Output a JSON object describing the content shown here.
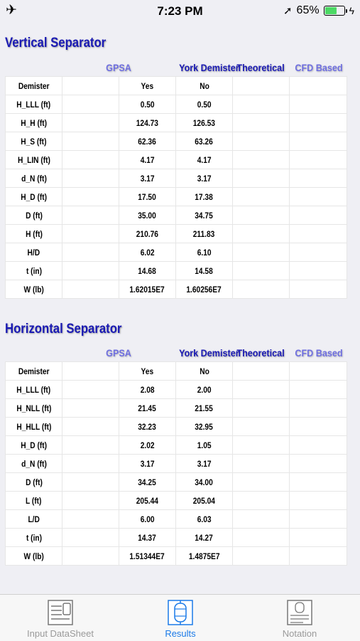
{
  "status_bar": {
    "time": "7:23 PM",
    "battery_text": "65%",
    "battery_level": 0.65,
    "battery_color": "#4cd964"
  },
  "columns": {
    "gpsa": "GPSA",
    "york": "York Demister",
    "theoretical": "Theoretical",
    "cfd": "CFD Based"
  },
  "vertical": {
    "title": "Vertical Separator",
    "rows": [
      {
        "label": "Demister",
        "gpsa": "",
        "york": "Yes",
        "theoretical": "No",
        "cfd": ""
      },
      {
        "label": "H_LLL (ft)",
        "gpsa": "",
        "york": "0.50",
        "theoretical": "0.50",
        "cfd": ""
      },
      {
        "label": "H_H (ft)",
        "gpsa": "",
        "york": "124.73",
        "theoretical": "126.53",
        "cfd": ""
      },
      {
        "label": "H_S (ft)",
        "gpsa": "",
        "york": "62.36",
        "theoretical": "63.26",
        "cfd": ""
      },
      {
        "label": "H_LIN (ft)",
        "gpsa": "",
        "york": "4.17",
        "theoretical": "4.17",
        "cfd": ""
      },
      {
        "label": "d_N (ft)",
        "gpsa": "",
        "york": "3.17",
        "theoretical": "3.17",
        "cfd": ""
      },
      {
        "label": "H_D (ft)",
        "gpsa": "",
        "york": "17.50",
        "theoretical": "17.38",
        "cfd": ""
      },
      {
        "label": "D (ft)",
        "gpsa": "",
        "york": "35.00",
        "theoretical": "34.75",
        "cfd": ""
      },
      {
        "label": "H (ft)",
        "gpsa": "",
        "york": "210.76",
        "theoretical": "211.83",
        "cfd": ""
      },
      {
        "label": "H/D",
        "gpsa": "",
        "york": "6.02",
        "theoretical": "6.10",
        "cfd": ""
      },
      {
        "label": "t (in)",
        "gpsa": "",
        "york": "14.68",
        "theoretical": "14.58",
        "cfd": ""
      },
      {
        "label": "W (lb)",
        "gpsa": "",
        "york": "1.62015E7",
        "theoretical": "1.60256E7",
        "cfd": ""
      }
    ]
  },
  "horizontal": {
    "title": "Horizontal Separator",
    "rows": [
      {
        "label": "Demister",
        "gpsa": "",
        "york": "Yes",
        "theoretical": "No",
        "cfd": ""
      },
      {
        "label": "H_LLL (ft)",
        "gpsa": "",
        "york": "2.08",
        "theoretical": "2.00",
        "cfd": ""
      },
      {
        "label": "H_NLL (ft)",
        "gpsa": "",
        "york": "21.45",
        "theoretical": "21.55",
        "cfd": ""
      },
      {
        "label": "H_HLL (ft)",
        "gpsa": "",
        "york": "32.23",
        "theoretical": "32.95",
        "cfd": ""
      },
      {
        "label": "H_D (ft)",
        "gpsa": "",
        "york": "2.02",
        "theoretical": "1.05",
        "cfd": ""
      },
      {
        "label": "d_N (ft)",
        "gpsa": "",
        "york": "3.17",
        "theoretical": "3.17",
        "cfd": ""
      },
      {
        "label": "D (ft)",
        "gpsa": "",
        "york": "34.25",
        "theoretical": "34.00",
        "cfd": ""
      },
      {
        "label": "L (ft)",
        "gpsa": "",
        "york": "205.44",
        "theoretical": "205.04",
        "cfd": ""
      },
      {
        "label": "L/D",
        "gpsa": "",
        "york": "6.00",
        "theoretical": "6.03",
        "cfd": ""
      },
      {
        "label": "t (in)",
        "gpsa": "",
        "york": "14.37",
        "theoretical": "14.27",
        "cfd": ""
      },
      {
        "label": "W (lb)",
        "gpsa": "",
        "york": "1.51344E7",
        "theoretical": "1.4875E7",
        "cfd": ""
      }
    ]
  },
  "tab_bar": {
    "tabs": [
      {
        "label": "Input DataSheet",
        "icon": "datasheet-icon",
        "active": false
      },
      {
        "label": "Results",
        "icon": "vessel-icon",
        "active": true
      },
      {
        "label": "Notation",
        "icon": "notation-icon",
        "active": false
      }
    ],
    "active_color": "#1a7ae8",
    "inactive_color": "#9a9a9a"
  }
}
